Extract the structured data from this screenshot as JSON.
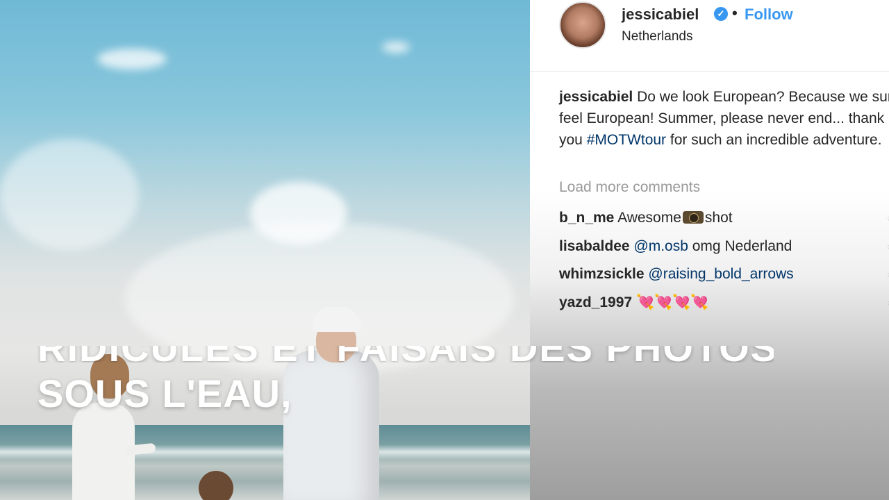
{
  "subtitle": {
    "partial_line": "RIDICULES ET FAISAIS DES PHOTOS",
    "line": "SOUS L'EAU,"
  },
  "post": {
    "username": "jessicabiel",
    "verified_icon": "verified-badge-icon",
    "separator": "•",
    "follow_label": "Follow",
    "location": "Netherlands",
    "caption_user": "jessicabiel",
    "caption_text_1": "Do we look European? Because we sure feel European! Summer, please never end... thank you ",
    "caption_hashtag": "#MOTWtour",
    "caption_text_2": " for such an incredible adventure.",
    "load_more": "Load more comments"
  },
  "comments": [
    {
      "user": "b_n_me",
      "pre": "Awesome",
      "emoji": "camera-emoji",
      "post": "shot"
    },
    {
      "user": "lisabaldee",
      "mention": "@m.osb",
      "text": " omg Nederland"
    },
    {
      "user": "whimzsickle",
      "mention": "@raising_bold_arrows",
      "text": ""
    },
    {
      "user": "yazd_1997",
      "hearts": "💘💘💘💘"
    }
  ],
  "colors": {
    "link_blue": "#3897f0",
    "hashtag_blue": "#003569",
    "text_dark": "#262626",
    "muted": "#999999"
  }
}
